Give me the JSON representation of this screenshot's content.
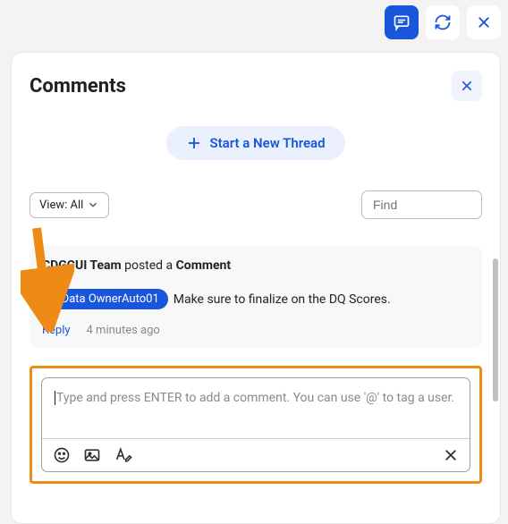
{
  "toolbar": {
    "comment_icon": "comment",
    "refresh_icon": "refresh",
    "close_icon": "close"
  },
  "panel": {
    "title": "Comments",
    "new_thread_label": "Start a New Thread",
    "view_label": "View: All",
    "find_placeholder": "Find"
  },
  "comment": {
    "author": "CDGCUI Team",
    "verb": " posted a ",
    "type": "Comment",
    "mention": "@Data OwnerAuto01",
    "text": "Make sure to finalize on the DQ Scores.",
    "reply_label": "Reply",
    "timestamp": "4 minutes ago"
  },
  "reply_box": {
    "placeholder": "Type and press ENTER to add a comment. You can use '@' to tag a user."
  }
}
